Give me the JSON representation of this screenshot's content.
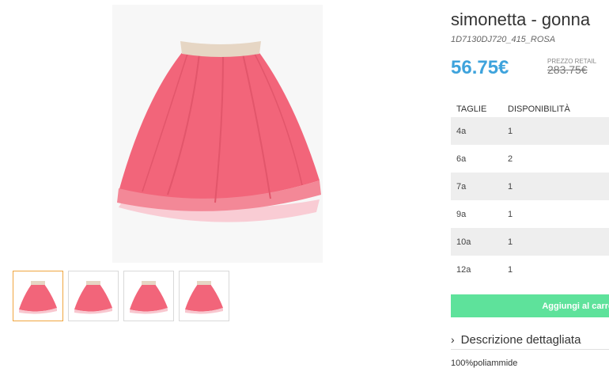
{
  "product": {
    "title": "simonetta - gonna",
    "sku": "1D7130DJ720_415_ROSA",
    "price": "56.75€",
    "retail_label": "PREZZO RETAIL",
    "retail_price": "283.75€"
  },
  "sizes_table": {
    "headers": [
      "TAGLIE",
      "DISPONIBILITÀ"
    ],
    "rows": [
      {
        "size": "4a",
        "qty": "1"
      },
      {
        "size": "6a",
        "qty": "2"
      },
      {
        "size": "7a",
        "qty": "1"
      },
      {
        "size": "9a",
        "qty": "1"
      },
      {
        "size": "10a",
        "qty": "1"
      },
      {
        "size": "12a",
        "qty": "1"
      }
    ]
  },
  "actions": {
    "add_label": "Aggiungi al carrello"
  },
  "description": {
    "heading": "Descrizione dettagliata",
    "text": "100%poliammide",
    "chevron_icon": "chevron-right-icon"
  },
  "colors": {
    "price": "#3ea3dc",
    "button": "#5ee29b",
    "thumb_active": "#f0a640",
    "skirt": "#f2657a"
  }
}
